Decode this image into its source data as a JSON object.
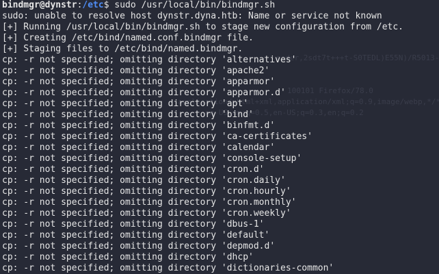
{
  "prompt": {
    "user_host": "bindmgr@dynstr",
    "separator": ":",
    "path": "/etc",
    "symbol": "$ ",
    "command": "sudo /usr/local/bin/bindmgr.sh"
  },
  "background_text": [
    "eader,2sdt7t+++t-S0TEDL)E55N)/R5013-gMOR4W5-s+I+bal",
    "100101 Firefox/78.0",
    "application/xhtml+xml,application/xml;q=0.9,image/webp,*/*;q=0.8",
    "en-US,en;q=0.5,en-US;q=0.3,en;q=0.2"
  ],
  "output": [
    "sudo: unable to resolve host dynstr.dyna.htb: Name or service not known",
    "[+] Running /usr/local/bin/bindmgr.sh to stage new configuration from /etc.",
    "[+] Creating /etc/bind/named.conf.bindmgr file.",
    "[+] Staging files to /etc/bind/named.bindmgr.",
    "cp: -r not specified; omitting directory 'alternatives'",
    "cp: -r not specified; omitting directory 'apache2'",
    "cp: -r not specified; omitting directory 'apparmor'",
    "cp: -r not specified; omitting directory 'apparmor.d'",
    "cp: -r not specified; omitting directory 'apt'",
    "cp: -r not specified; omitting directory 'bind'",
    "cp: -r not specified; omitting directory 'binfmt.d'",
    "cp: -r not specified; omitting directory 'ca-certificates'",
    "cp: -r not specified; omitting directory 'calendar'",
    "cp: -r not specified; omitting directory 'console-setup'",
    "cp: -r not specified; omitting directory 'cron.d'",
    "cp: -r not specified; omitting directory 'cron.daily'",
    "cp: -r not specified; omitting directory 'cron.hourly'",
    "cp: -r not specified; omitting directory 'cron.monthly'",
    "cp: -r not specified; omitting directory 'cron.weekly'",
    "cp: -r not specified; omitting directory 'dbus-1'",
    "cp: -r not specified; omitting directory 'default'",
    "cp: -r not specified; omitting directory 'depmod.d'",
    "cp: -r not specified; omitting directory 'dhcp'",
    "cp: -r not specified; omitting directory 'dictionaries-common'"
  ],
  "colors": {
    "background": "#272a36",
    "text": "#e6e6e6",
    "path": "#4f8df5"
  }
}
